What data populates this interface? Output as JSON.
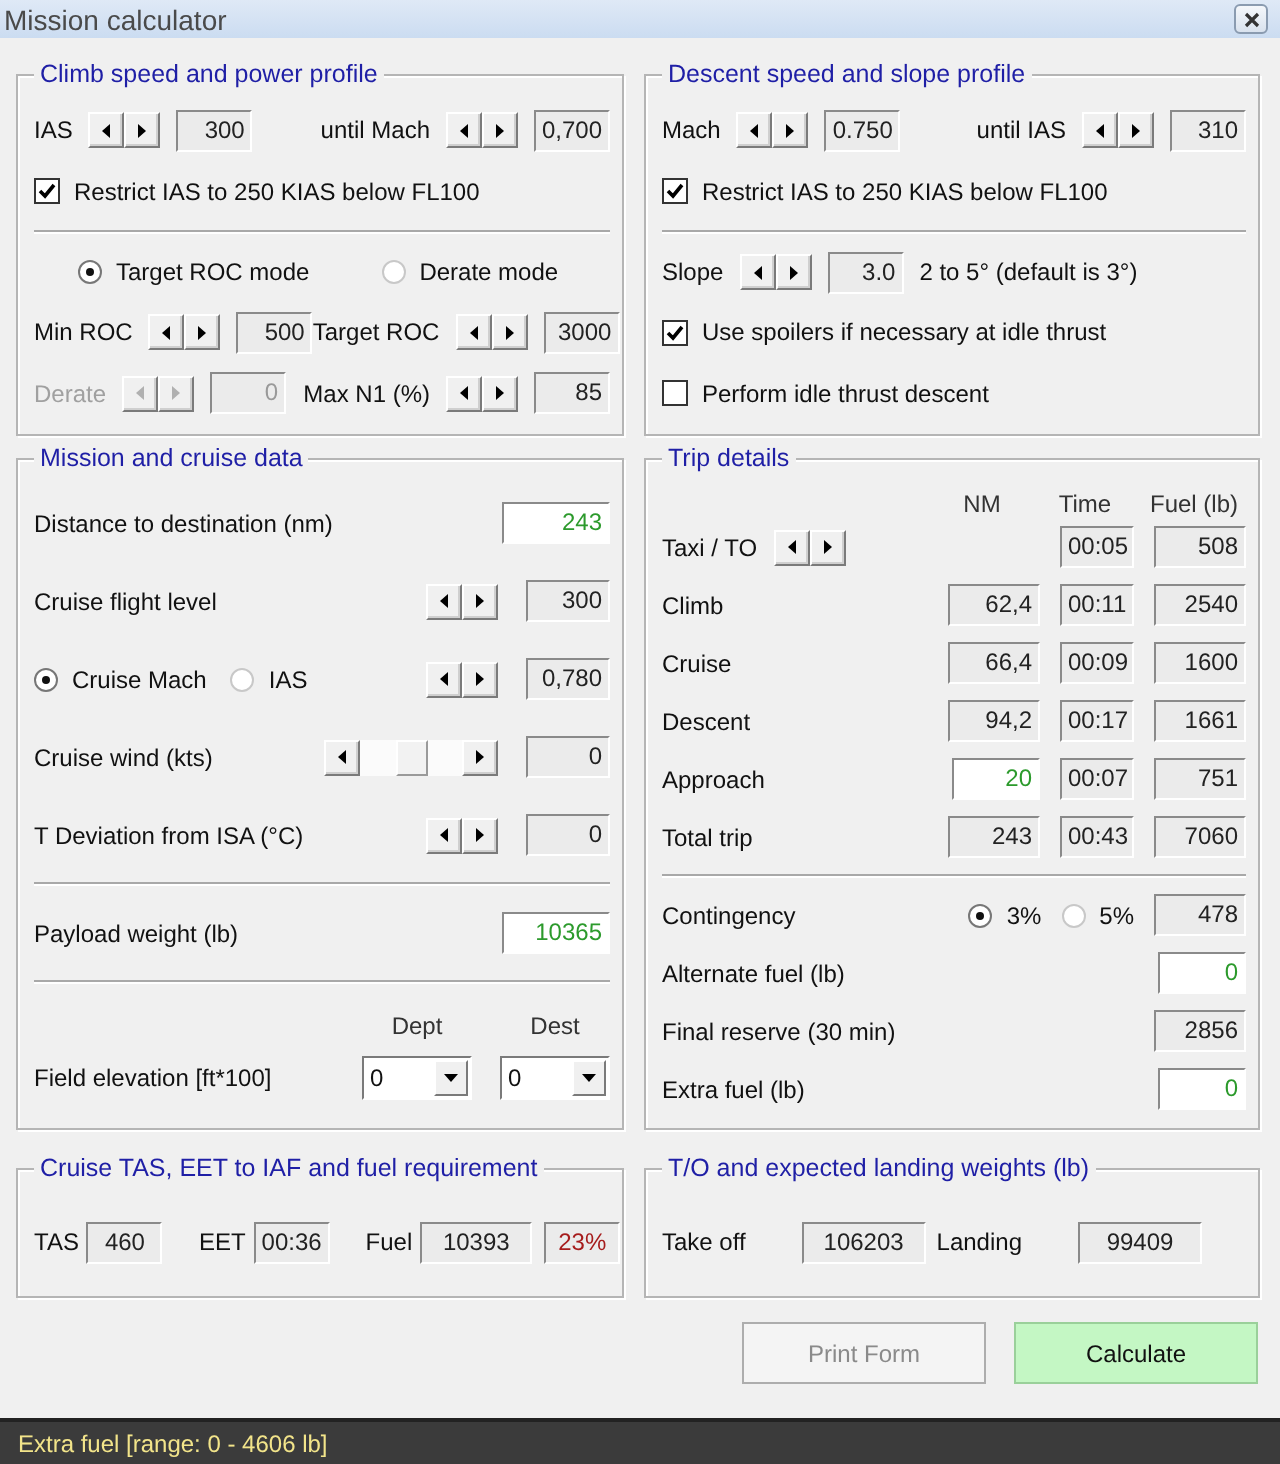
{
  "window": {
    "title": "Mission calculator"
  },
  "groups": [
    {
      "title": "Climb speed and power profile",
      "rows": [
        {
          "kind": "line",
          "left": [
            {
              "kind": "text",
              "text": "IAS",
              "disabled": false
            },
            {
              "kind": "spin",
              "disabled": false
            },
            {
              "kind": "value",
              "text": "300",
              "editable": false,
              "disabled": false
            }
          ],
          "right": [
            {
              "kind": "text",
              "text": "until Mach",
              "disabled": false
            },
            {
              "kind": "spin",
              "disabled": false
            },
            {
              "kind": "value",
              "text": "0,700",
              "editable": false,
              "disabled": false
            }
          ]
        },
        {
          "kind": "line",
          "left": [
            {
              "kind": "check",
              "label": "Restrict IAS to 250 KIAS below FL100",
              "checked": true
            }
          ]
        },
        {
          "kind": "rule"
        },
        {
          "kind": "line",
          "left": [
            {
              "kind": "radio",
              "label": "Target ROC mode",
              "selected": true
            },
            {
              "kind": "radio",
              "label": "Derate mode",
              "selected": false
            }
          ]
        },
        {
          "kind": "line",
          "left": [
            {
              "kind": "text",
              "text": "Min ROC",
              "disabled": false
            },
            {
              "kind": "spin",
              "disabled": false
            },
            {
              "kind": "value",
              "text": "500",
              "editable": false,
              "disabled": false
            }
          ],
          "right": [
            {
              "kind": "text",
              "text": "Target ROC",
              "disabled": false
            },
            {
              "kind": "spin",
              "disabled": false
            },
            {
              "kind": "value",
              "text": "3000",
              "editable": false,
              "disabled": false
            }
          ]
        },
        {
          "kind": "line",
          "left": [
            {
              "kind": "text",
              "text": "Derate",
              "disabled": true
            },
            {
              "kind": "spin",
              "disabled": true
            },
            {
              "kind": "value",
              "text": "0",
              "editable": false,
              "disabled": true
            }
          ],
          "right": [
            {
              "kind": "text",
              "text": "Max N1 (%)",
              "disabled": false
            },
            {
              "kind": "spin",
              "disabled": false
            },
            {
              "kind": "value",
              "text": "85",
              "editable": false,
              "disabled": false
            }
          ]
        }
      ]
    },
    {
      "title": "Descent speed and slope profile",
      "rows": [
        {
          "kind": "line",
          "left": [
            {
              "kind": "text",
              "text": "Mach",
              "disabled": false
            },
            {
              "kind": "spin",
              "disabled": false
            },
            {
              "kind": "value",
              "text": "0.750",
              "editable": false,
              "disabled": false
            }
          ],
          "right": [
            {
              "kind": "text",
              "text": "until IAS",
              "disabled": false
            },
            {
              "kind": "spin",
              "disabled": false
            },
            {
              "kind": "value",
              "text": "310",
              "editable": false,
              "disabled": false
            }
          ]
        },
        {
          "kind": "line",
          "left": [
            {
              "kind": "check",
              "label": "Restrict IAS to 250 KIAS below FL100",
              "checked": true
            }
          ]
        },
        {
          "kind": "rule"
        },
        {
          "kind": "line",
          "left": [
            {
              "kind": "text",
              "text": "Slope",
              "disabled": false
            },
            {
              "kind": "spin",
              "disabled": false
            },
            {
              "kind": "value",
              "text": "3.0",
              "editable": false,
              "disabled": false
            },
            {
              "kind": "text",
              "text": "2 to 5° (default is 3°)",
              "disabled": false
            }
          ]
        },
        {
          "kind": "line",
          "left": [
            {
              "kind": "check",
              "label": "Use spoilers if necessary at idle thrust",
              "checked": true
            }
          ]
        },
        {
          "kind": "line",
          "left": [
            {
              "kind": "check",
              "label": "Perform idle thrust descent",
              "checked": false
            }
          ]
        }
      ]
    },
    {
      "title": "Mission and cruise data",
      "rows": [
        {
          "kind": "line",
          "left": [
            {
              "kind": "text",
              "text": "Distance to destination (nm)",
              "disabled": false
            }
          ],
          "right": [
            {
              "kind": "value",
              "text": "243",
              "editable": true,
              "disabled": false
            }
          ]
        },
        {
          "kind": "line",
          "left": [
            {
              "kind": "text",
              "text": "Cruise flight level",
              "disabled": false
            }
          ],
          "right": [
            {
              "kind": "spin",
              "disabled": false
            },
            {
              "kind": "value",
              "text": "300",
              "editable": false,
              "disabled": false
            }
          ]
        },
        {
          "kind": "line",
          "left": [
            {
              "kind": "radio",
              "label": "Cruise Mach",
              "selected": true
            },
            {
              "kind": "radio",
              "label": "IAS",
              "selected": false
            }
          ],
          "right": [
            {
              "kind": "spin",
              "disabled": false
            },
            {
              "kind": "value",
              "text": "0,780",
              "editable": false,
              "disabled": false
            }
          ]
        },
        {
          "kind": "line",
          "left": [
            {
              "kind": "text",
              "text": "Cruise wind (kts)",
              "disabled": false
            }
          ],
          "right": [
            {
              "kind": "slider",
              "level": 0.5
            },
            {
              "kind": "value",
              "text": "0",
              "editable": false,
              "disabled": false
            }
          ]
        },
        {
          "kind": "line",
          "left": [
            {
              "kind": "text",
              "text": "T Deviation from ISA (°C)",
              "disabled": false
            }
          ],
          "right": [
            {
              "kind": "spin",
              "disabled": false
            },
            {
              "kind": "value",
              "text": "0",
              "editable": false,
              "disabled": false
            }
          ]
        },
        {
          "kind": "rule"
        },
        {
          "kind": "line",
          "left": [
            {
              "kind": "text",
              "text": "Payload weight (lb)",
              "disabled": false
            }
          ],
          "right": [
            {
              "kind": "value",
              "text": "10365",
              "editable": true,
              "disabled": false
            }
          ]
        },
        {
          "kind": "rule"
        },
        {
          "kind": "header",
          "right": [
            {
              "kind": "heading",
              "text": "Dept"
            },
            {
              "kind": "heading",
              "text": "Dest"
            }
          ]
        },
        {
          "kind": "line",
          "left": [
            {
              "kind": "text",
              "text": "Field elevation [ft*100]",
              "disabled": false
            }
          ],
          "right": [
            {
              "kind": "dropdown",
              "value": "0"
            },
            {
              "kind": "dropdown",
              "value": "0"
            }
          ]
        }
      ]
    },
    {
      "title": "Trip details",
      "rows": [
        {
          "kind": "header",
          "right": [
            {
              "kind": "heading",
              "text": "NM"
            },
            {
              "kind": "heading",
              "text": "Time"
            },
            {
              "kind": "heading",
              "text": "Fuel (lb)"
            }
          ]
        },
        {
          "kind": "line",
          "left": [
            {
              "kind": "text",
              "text": "Taxi / TO",
              "disabled": false
            },
            {
              "kind": "spin",
              "disabled": false
            }
          ],
          "right": [
            {
              "kind": "value",
              "text": "00:05",
              "editable": false,
              "disabled": false
            },
            {
              "kind": "value",
              "text": "508",
              "editable": false,
              "disabled": false
            }
          ]
        },
        {
          "kind": "line",
          "left": [
            {
              "kind": "text",
              "text": "Climb",
              "disabled": false
            }
          ],
          "right": [
            {
              "kind": "value",
              "text": "62,4",
              "editable": false,
              "disabled": false
            },
            {
              "kind": "value",
              "text": "00:11",
              "editable": false,
              "disabled": false
            },
            {
              "kind": "value",
              "text": "2540",
              "editable": false,
              "disabled": false
            }
          ]
        },
        {
          "kind": "line",
          "left": [
            {
              "kind": "text",
              "text": "Cruise",
              "disabled": false
            }
          ],
          "right": [
            {
              "kind": "value",
              "text": "66,4",
              "editable": false,
              "disabled": false
            },
            {
              "kind": "value",
              "text": "00:09",
              "editable": false,
              "disabled": false
            },
            {
              "kind": "value",
              "text": "1600",
              "editable": false,
              "disabled": false
            }
          ]
        },
        {
          "kind": "line",
          "left": [
            {
              "kind": "text",
              "text": "Descent",
              "disabled": false
            }
          ],
          "right": [
            {
              "kind": "value",
              "text": "94,2",
              "editable": false,
              "disabled": false
            },
            {
              "kind": "value",
              "text": "00:17",
              "editable": false,
              "disabled": false
            },
            {
              "kind": "value",
              "text": "1661",
              "editable": false,
              "disabled": false
            }
          ]
        },
        {
          "kind": "line",
          "left": [
            {
              "kind": "text",
              "text": "Approach",
              "disabled": false
            }
          ],
          "right": [
            {
              "kind": "value",
              "text": "20",
              "editable": true,
              "disabled": false
            },
            {
              "kind": "value",
              "text": "00:07",
              "editable": false,
              "disabled": false
            },
            {
              "kind": "value",
              "text": "751",
              "editable": false,
              "disabled": false
            }
          ]
        },
        {
          "kind": "line",
          "left": [
            {
              "kind": "text",
              "text": "Total trip",
              "disabled": false
            }
          ],
          "right": [
            {
              "kind": "value",
              "text": "243",
              "editable": false,
              "disabled": false
            },
            {
              "kind": "value",
              "text": "00:43",
              "editable": false,
              "disabled": false
            },
            {
              "kind": "value",
              "text": "7060",
              "editable": false,
              "disabled": false
            }
          ]
        },
        {
          "kind": "rule"
        },
        {
          "kind": "line",
          "left": [
            {
              "kind": "text",
              "text": "Contingency",
              "disabled": false
            }
          ],
          "right": [
            {
              "kind": "radio",
              "label": "3%",
              "selected": true
            },
            {
              "kind": "radio",
              "label": "5%",
              "selected": false
            },
            {
              "kind": "value",
              "text": "478",
              "editable": false,
              "disabled": false
            }
          ]
        },
        {
          "kind": "line",
          "left": [
            {
              "kind": "text",
              "text": "Alternate fuel (lb)",
              "disabled": false
            }
          ],
          "right": [
            {
              "kind": "value",
              "text": "0",
              "editable": true,
              "disabled": false
            }
          ]
        },
        {
          "kind": "line",
          "left": [
            {
              "kind": "text",
              "text": "Final reserve (30 min)",
              "disabled": false
            }
          ],
          "right": [
            {
              "kind": "value",
              "text": "2856",
              "editable": false,
              "disabled": false
            }
          ]
        },
        {
          "kind": "line",
          "left": [
            {
              "kind": "text",
              "text": "Extra fuel (lb)",
              "disabled": false
            }
          ],
          "right": [
            {
              "kind": "value",
              "text": "0",
              "editable": true,
              "disabled": false
            }
          ]
        }
      ]
    },
    {
      "title": "Cruise TAS, EET to IAF and fuel requirement",
      "rows": [
        {
          "kind": "line",
          "left": [
            {
              "kind": "text",
              "text": "TAS",
              "disabled": false
            },
            {
              "kind": "value",
              "text": "460",
              "editable": false,
              "disabled": false,
              "alert": false
            },
            {
              "kind": "text",
              "text": "EET",
              "disabled": false
            },
            {
              "kind": "value",
              "text": "00:36",
              "editable": false,
              "disabled": false,
              "alert": false
            },
            {
              "kind": "text",
              "text": "Fuel",
              "disabled": false
            },
            {
              "kind": "value",
              "text": "10393",
              "editable": false,
              "disabled": false,
              "alert": false
            },
            {
              "kind": "value",
              "text": "23%",
              "editable": false,
              "disabled": false,
              "alert": true
            }
          ]
        }
      ]
    },
    {
      "title": "T/O and expected landing weights (lb)",
      "rows": [
        {
          "kind": "line",
          "left": [
            {
              "kind": "text",
              "text": "Take off",
              "disabled": false
            },
            {
              "kind": "value",
              "text": "106203",
              "editable": false,
              "disabled": false
            }
          ],
          "right": [
            {
              "kind": "text",
              "text": "Landing",
              "disabled": false
            },
            {
              "kind": "value",
              "text": "99409",
              "editable": false,
              "disabled": false
            }
          ]
        }
      ]
    }
  ],
  "buttons": [
    {
      "label": "Print Form",
      "disabled": true,
      "highlighted": false
    },
    {
      "label": "Calculate",
      "disabled": false,
      "highlighted": true
    }
  ],
  "status_bar": {
    "text": "Extra fuel [range: 0 - 4606 lb]"
  }
}
